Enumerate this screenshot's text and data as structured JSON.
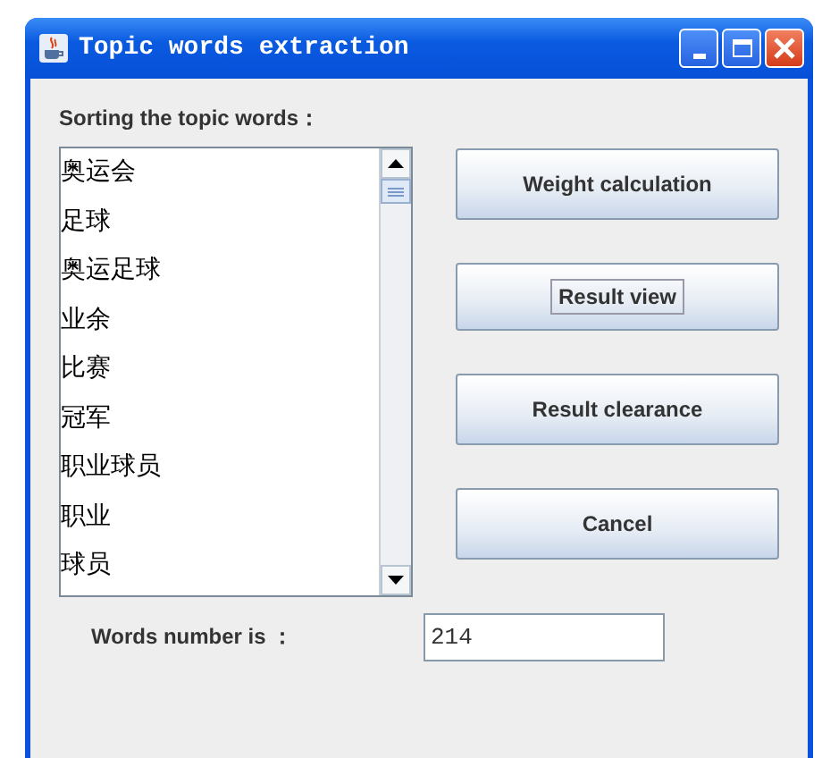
{
  "window": {
    "title": "Topic words extraction"
  },
  "list_label": "Sorting the topic words：",
  "topic_words": [
    "奥运会",
    "足球",
    "奥运足球",
    "业余",
    "比赛",
    "冠军",
    "职业球员",
    "职业",
    "球员"
  ],
  "buttons": [
    {
      "label": "Weight calculation",
      "focused": false
    },
    {
      "label": "Result view",
      "focused": true
    },
    {
      "label": "Result clearance",
      "focused": false
    },
    {
      "label": "Cancel",
      "focused": false
    }
  ],
  "words_number": {
    "label": "Words number is ：",
    "value": "214"
  }
}
